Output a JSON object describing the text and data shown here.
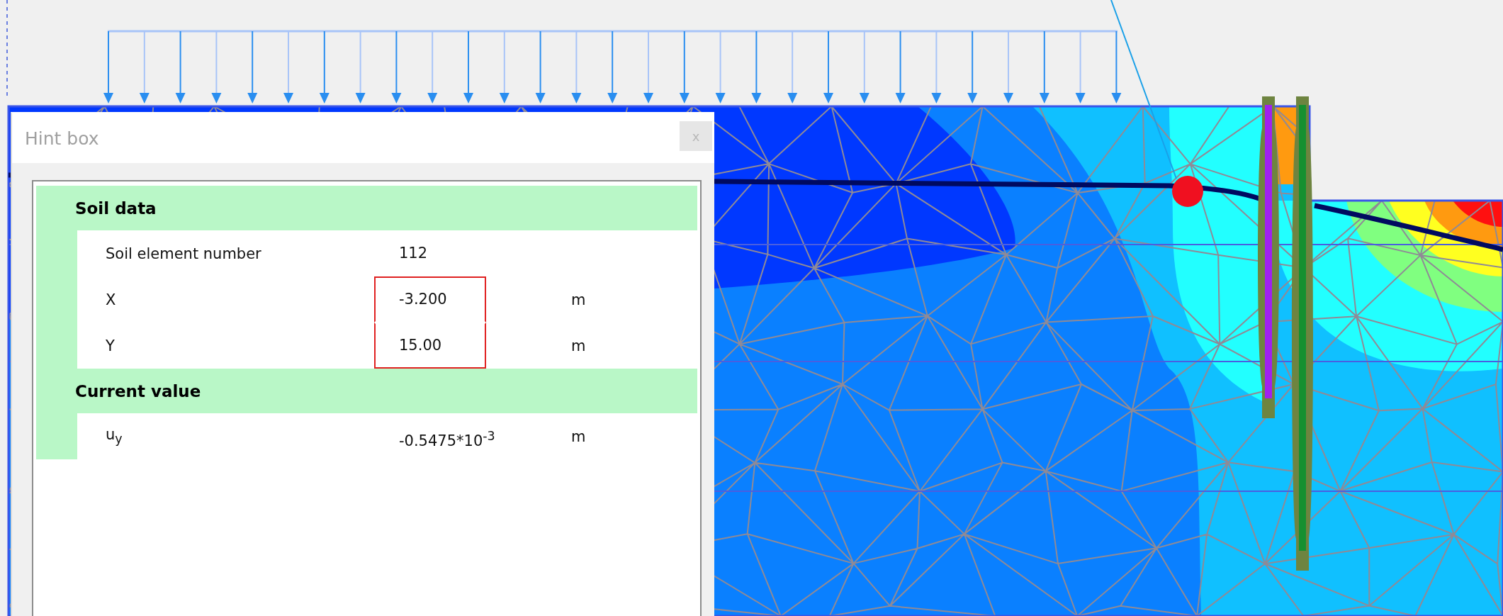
{
  "hint_box": {
    "title": "Hint box",
    "close_label": "x",
    "sections": [
      {
        "title": "Soil data",
        "rows": [
          {
            "label": "Soil element number",
            "value": "112",
            "highlighted": false
          },
          {
            "label": "X",
            "value": "-3.200",
            "unit": "m",
            "highlighted": true
          },
          {
            "label": "Y",
            "value": "15.00",
            "unit": "m",
            "highlighted": true
          }
        ]
      },
      {
        "title": "Current value",
        "rows": [
          {
            "label": "u$_{y}$",
            "value": "-0.5475*10$^{-3}$",
            "unit": "m",
            "highlighted": false
          }
        ]
      }
    ]
  }
}
